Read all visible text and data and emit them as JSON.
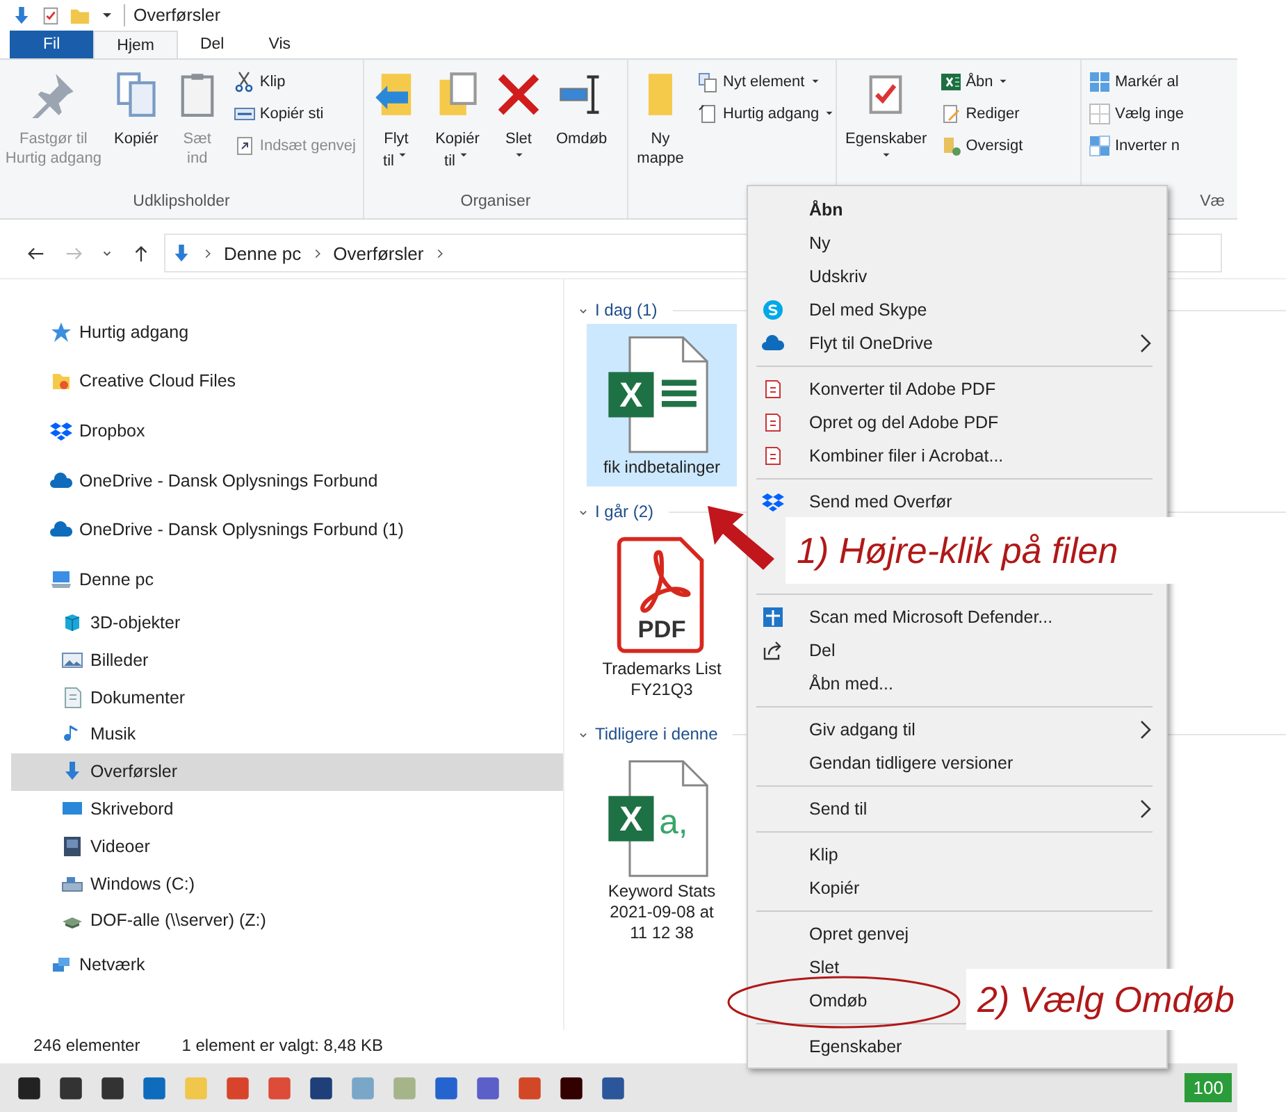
{
  "window": {
    "title": "Overførsler"
  },
  "ribbon": {
    "tabs": [
      {
        "label": "Fil",
        "kind": "file",
        "selected": false
      },
      {
        "label": "Hjem",
        "kind": "tab",
        "selected": true
      },
      {
        "label": "Del",
        "kind": "tab",
        "selected": false
      },
      {
        "label": "Vis",
        "kind": "tab",
        "selected": false
      }
    ],
    "groups": [
      {
        "label": "Udklipsholder",
        "large": [
          {
            "lines": [
              "Fastgør til",
              "Hurtig adgang"
            ],
            "disabled": true,
            "dropdown": false
          },
          {
            "lines": [
              "Kopiér"
            ],
            "disabled": false,
            "dropdown": false
          },
          {
            "lines": [
              "Sæt",
              "ind"
            ],
            "disabled": true,
            "dropdown": false
          }
        ],
        "small": [
          {
            "label": "Klip",
            "disabled": false,
            "dropdown": false
          },
          {
            "label": "Kopiér sti",
            "disabled": false,
            "dropdown": false
          },
          {
            "label": "Indsæt genvej",
            "disabled": true,
            "dropdown": false
          }
        ]
      },
      {
        "label": "Organiser",
        "large": [
          {
            "lines": [
              "Flyt",
              "til"
            ],
            "disabled": false,
            "dropdown": true
          },
          {
            "lines": [
              "Kopiér",
              "til"
            ],
            "disabled": false,
            "dropdown": true
          },
          {
            "lines": [
              "Slet"
            ],
            "disabled": false,
            "dropdown": true
          },
          {
            "lines": [
              "Omdøb"
            ],
            "disabled": false,
            "dropdown": false
          }
        ]
      },
      {
        "large": [
          {
            "lines": [
              "Ny",
              "mappe"
            ],
            "disabled": false,
            "dropdown": false
          }
        ],
        "small": [
          {
            "label": "Nyt element",
            "disabled": false,
            "dropdown": true
          },
          {
            "label": "Hurtig adgang",
            "disabled": false,
            "dropdown": true
          }
        ]
      },
      {
        "large": [
          {
            "lines": [
              "Egenskaber"
            ],
            "disabled": false,
            "dropdown": true
          }
        ],
        "small": [
          {
            "label": "Åbn",
            "disabled": false,
            "dropdown": true
          },
          {
            "label": "Rediger",
            "disabled": false,
            "dropdown": false
          },
          {
            "label": "Oversigt",
            "disabled": false,
            "dropdown": false
          }
        ]
      },
      {
        "label": "Væ",
        "small": [
          {
            "label": "Markér al",
            "disabled": false,
            "dropdown": false
          },
          {
            "label": "Vælg inge",
            "disabled": false,
            "dropdown": false
          },
          {
            "label": "Inverter n",
            "disabled": false,
            "dropdown": false
          }
        ]
      }
    ]
  },
  "address_bar": {
    "path": [
      "Denne pc",
      "Overførsler"
    ]
  },
  "navigation": [
    {
      "label": "Hurtig adgang",
      "selected": false
    },
    {
      "label": "Creative Cloud Files",
      "selected": false
    },
    {
      "label": "Dropbox",
      "selected": false
    },
    {
      "label": "OneDrive - Dansk Oplysnings Forbund",
      "selected": false
    },
    {
      "label": "OneDrive - Dansk Oplysnings Forbund (1)",
      "selected": false
    },
    {
      "label": "Denne pc",
      "selected": false,
      "children": [
        {
          "label": "3D-objekter",
          "selected": false
        },
        {
          "label": "Billeder",
          "selected": false
        },
        {
          "label": "Dokumenter",
          "selected": false
        },
        {
          "label": "Musik",
          "selected": false
        },
        {
          "label": "Overførsler",
          "selected": true
        },
        {
          "label": "Skrivebord",
          "selected": false
        },
        {
          "label": "Videoer",
          "selected": false
        },
        {
          "label": "Windows (C:)",
          "selected": false
        },
        {
          "label": "DOF-alle (\\\\server) (Z:)",
          "selected": false
        }
      ]
    },
    {
      "label": "Netværk",
      "selected": false
    }
  ],
  "file_groups": [
    {
      "title": "I dag (1)",
      "files": [
        {
          "name": "fik indbetalinger",
          "kind": "excel",
          "badge": "X",
          "selected": true
        }
      ]
    },
    {
      "title": "I går (2)",
      "files": [
        {
          "name": "Trademarks List FY21Q3",
          "kind": "pdf",
          "badge": "PDF",
          "selected": false
        }
      ]
    },
    {
      "title": "Tidligere i denne",
      "files": [
        {
          "name": "Keyword Stats 2021-09-08 at 11 12 38",
          "kind": "csv",
          "badge": "X",
          "glyph": "a,",
          "selected": false
        }
      ]
    }
  ],
  "context_menu": [
    [
      {
        "label": "Åbn",
        "default": true,
        "submenu": false
      },
      {
        "label": "Ny",
        "default": false,
        "submenu": false
      },
      {
        "label": "Udskriv",
        "default": false,
        "submenu": false
      },
      {
        "label": "Del med Skype",
        "default": false,
        "submenu": false
      },
      {
        "label": "Flyt til OneDrive",
        "default": false,
        "submenu": true
      }
    ],
    [
      {
        "label": "Konverter til Adobe PDF",
        "default": false,
        "submenu": false
      },
      {
        "label": "Opret og del Adobe PDF",
        "default": false,
        "submenu": false
      },
      {
        "label": "Kombiner filer i Acrobat...",
        "default": false,
        "submenu": false
      }
    ],
    [
      {
        "label": "Send med Overfør",
        "default": false,
        "submenu": false
      }
    ],
    [
      {
        "label": "Scan med Microsoft Defender...",
        "default": false,
        "submenu": false
      },
      {
        "label": "Del",
        "default": false,
        "submenu": false
      },
      {
        "label": "Åbn med...",
        "default": false,
        "submenu": false
      }
    ],
    [
      {
        "label": "Giv adgang til",
        "default": false,
        "submenu": true
      },
      {
        "label": "Gendan tidligere versioner",
        "default": false,
        "submenu": false
      }
    ],
    [
      {
        "label": "Send til",
        "default": false,
        "submenu": true
      }
    ],
    [
      {
        "label": "Klip",
        "default": false,
        "submenu": false
      },
      {
        "label": "Kopiér",
        "default": false,
        "submenu": false
      }
    ],
    [
      {
        "label": "Opret genvej",
        "default": false,
        "submenu": false
      },
      {
        "label": "Slet",
        "default": false,
        "submenu": false
      },
      {
        "label": "Omdøb",
        "default": false,
        "submenu": false
      }
    ],
    [
      {
        "label": "Egenskaber",
        "default": false,
        "submenu": false
      }
    ]
  ],
  "annotations": [
    {
      "text": "1) Højre-klik på filen"
    },
    {
      "text": "2) Vælg Omdøb"
    }
  ],
  "status_bar": {
    "count": "246 elementer",
    "selection": "1 element er valgt: 8,48 KB"
  },
  "taskbar": {
    "battery": "100"
  }
}
